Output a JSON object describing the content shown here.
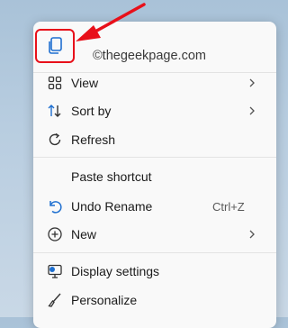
{
  "watermark": "©thegeekpage.com",
  "toolbar": {
    "copy_icon": "copy-icon"
  },
  "menu": {
    "view": {
      "label": "View",
      "icon": "view-grid-icon"
    },
    "sort_by": {
      "label": "Sort by",
      "icon": "sort-icon"
    },
    "refresh": {
      "label": "Refresh",
      "icon": "refresh-icon"
    },
    "paste_shortcut": {
      "label": "Paste shortcut"
    },
    "undo_rename": {
      "label": "Undo Rename",
      "shortcut": "Ctrl+Z",
      "icon": "undo-icon"
    },
    "new": {
      "label": "New",
      "icon": "new-plus-icon"
    },
    "display_settings": {
      "label": "Display settings",
      "icon": "display-settings-icon"
    },
    "personalize": {
      "label": "Personalize",
      "icon": "brush-icon"
    }
  },
  "colors": {
    "highlight": "#e8101a",
    "accent": "#0067c0",
    "menu_bg": "#f9f9f9"
  }
}
